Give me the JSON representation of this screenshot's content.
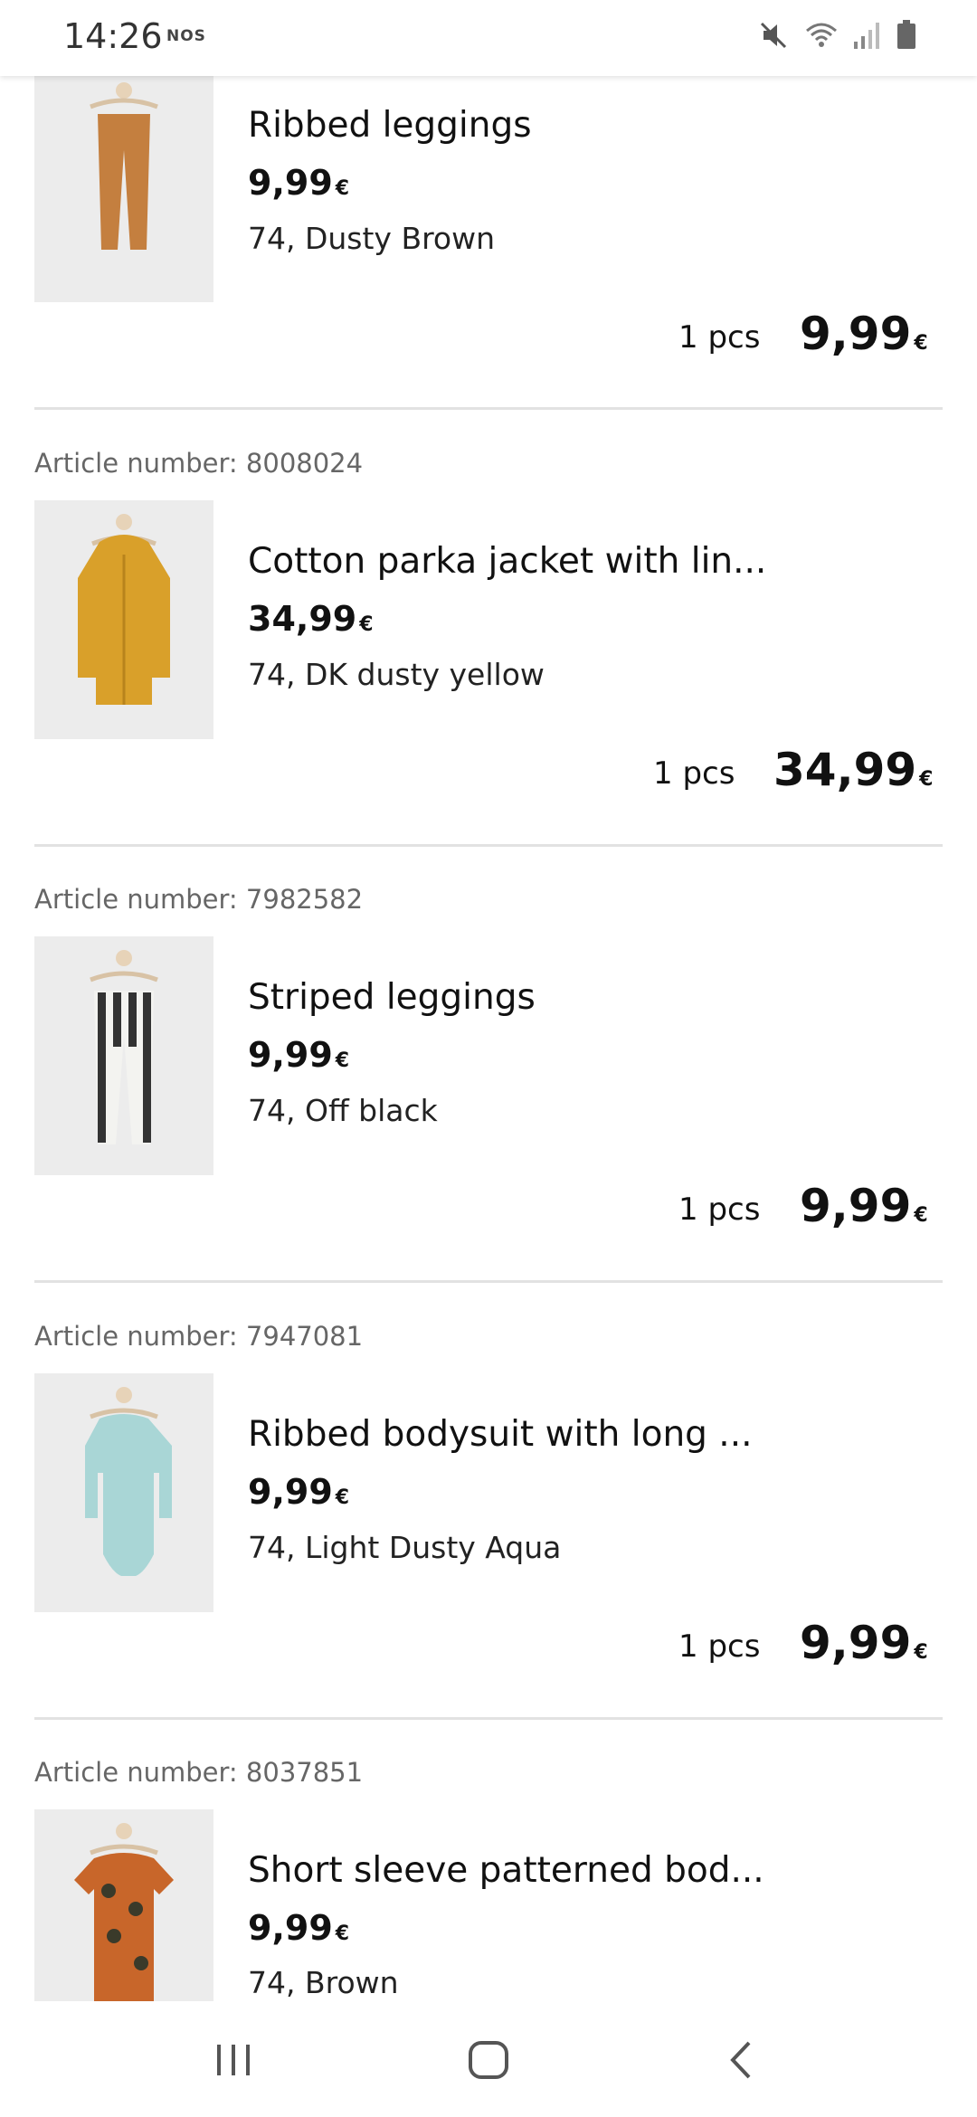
{
  "status_bar": {
    "time": "14:26",
    "carrier": "NOS",
    "icons": [
      "mute-icon",
      "wifi-icon",
      "signal-icon",
      "battery-icon"
    ]
  },
  "items": [
    {
      "article_label": "",
      "name": "Ribbed leggings",
      "unit_price": "9,99",
      "currency": "€",
      "variant": "74, Dusty Brown",
      "qty": "1 pcs",
      "total": "9,99",
      "image": "ribbed-leggings-image"
    },
    {
      "article_label": "Article number: 8008024",
      "name": "Cotton parka jacket with lin...",
      "unit_price": "34,99",
      "currency": "€",
      "variant": "74, DK dusty yellow",
      "qty": "1 pcs",
      "total": "34,99",
      "image": "parka-jacket-image"
    },
    {
      "article_label": "Article number: 7982582",
      "name": "Striped leggings",
      "unit_price": "9,99",
      "currency": "€",
      "variant": "74, Off black",
      "qty": "1 pcs",
      "total": "9,99",
      "image": "striped-leggings-image"
    },
    {
      "article_label": "Article number: 7947081",
      "name": "Ribbed bodysuit with long ...",
      "unit_price": "9,99",
      "currency": "€",
      "variant": "74, Light Dusty Aqua",
      "qty": "1 pcs",
      "total": "9,99",
      "image": "ribbed-bodysuit-image"
    },
    {
      "article_label": "Article number: 8037851",
      "name": "Short sleeve patterned bod...",
      "unit_price": "9,99",
      "currency": "€",
      "variant": "74, Brown",
      "image": "patterned-bodysuit-image"
    }
  ],
  "nav_bar": {
    "buttons": [
      "recent-apps-icon",
      "home-icon",
      "back-icon"
    ]
  },
  "colors": {
    "leggings_brown": "#c47f3f",
    "parka_yellow": "#d9a02a",
    "aqua": "#a9d6d6",
    "bodysuit_orange": "#c8662a"
  }
}
